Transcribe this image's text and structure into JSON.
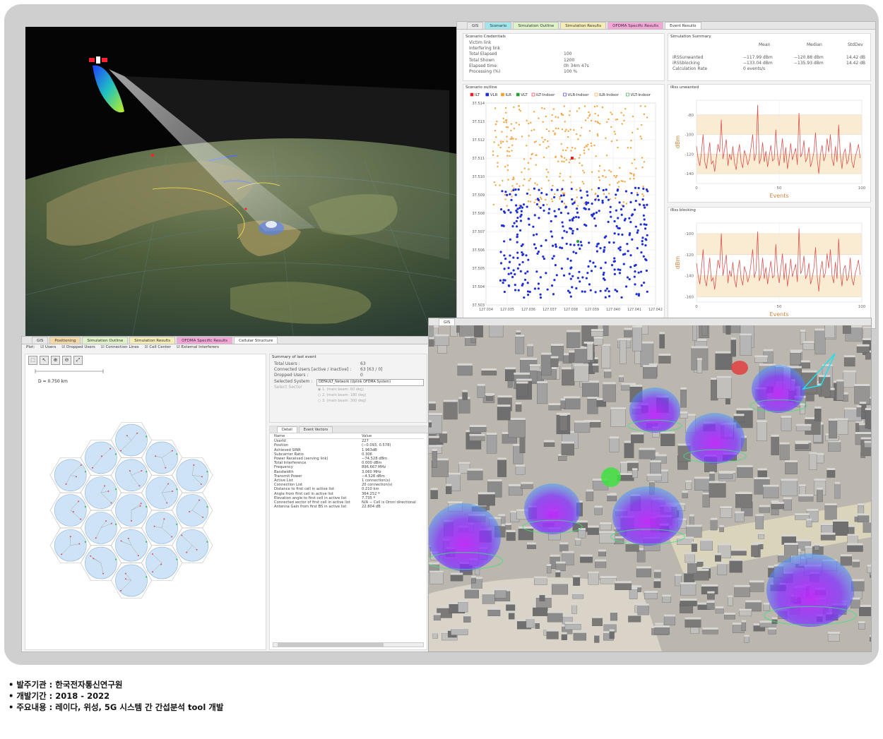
{
  "window_tabs_top": [
    {
      "label": "GIS",
      "color": "#e9e9e9"
    },
    {
      "label": "Scenario",
      "color": "#9fe6ef"
    },
    {
      "label": "Simulation Outline",
      "color": "#dff3c7"
    },
    {
      "label": "Simulation Results",
      "color": "#f6ecb6"
    },
    {
      "label": "OFDMA Specific Results",
      "color": "#f4a6d9"
    },
    {
      "label": "Event Results",
      "color": "#ffffff"
    }
  ],
  "window_tabs_bottom": [
    {
      "label": "GIS",
      "color": "#e9e9e9"
    },
    {
      "label": "Positioning",
      "color": "#f4d9a6"
    },
    {
      "label": "Simulation Outline",
      "color": "#dff3c7"
    },
    {
      "label": "Simulation Results",
      "color": "#f6ecb6"
    },
    {
      "label": "OFDMA Specific Results",
      "color": "#f4a6d9"
    },
    {
      "label": "Cellular Structure",
      "color": "#ffffff"
    }
  ],
  "city_tab": "GIS",
  "scenario_credentials": {
    "title": "Scenario Credentials",
    "labels": [
      "Victim link",
      "Interfering link",
      "Total Elapsed",
      "Total Shown",
      "Elapsed time:",
      "Processing (%)"
    ],
    "values": [
      "",
      "",
      "100",
      "1200",
      "0h 34m 47s",
      "100 %"
    ]
  },
  "simulation_summary": {
    "title": "Simulation Summary",
    "headers": [
      "Mean",
      "Median",
      "StdDev"
    ],
    "rows": [
      {
        "label": "iRSSunwanted",
        "mean": "−117.99 dBm",
        "median": "−120.88 dBm",
        "std": "14.42 dB"
      },
      {
        "label": "iRSSblocking",
        "mean": "−133.04 dBm",
        "median": "−135.93 dBm",
        "std": "14.42 dB"
      },
      {
        "label": "Calculation Rate",
        "mean": "0 events/s",
        "median": "",
        "std": ""
      }
    ]
  },
  "scenario_outline": {
    "title": "Scenario outline",
    "legend": [
      "ILT",
      "VLR",
      "ILR",
      "VLT",
      "ILT-Indoor",
      "VLR-Indoor",
      "ILR-Indoor",
      "VLT-Indoor"
    ],
    "y_ticks": [
      "37.514",
      "37.513",
      "37.512",
      "37.511",
      "37.510",
      "37.509",
      "37.508",
      "37.507",
      "37.506",
      "37.505",
      "37.504",
      "37.503"
    ],
    "x_ticks": [
      "127.034",
      "127.035",
      "127.036",
      "127.037",
      "127.038",
      "127.039",
      "127.040",
      "127.041",
      "127.042"
    ]
  },
  "chart_data": [
    {
      "type": "line",
      "title": "iRss unwanted",
      "ylabel": "dBm",
      "xlabel": "Events",
      "xlim": [
        0,
        100
      ],
      "ylim": [
        -150,
        -65
      ],
      "y_ticks": [
        "-80",
        "-100",
        "-120",
        "-140"
      ],
      "x_ticks": [
        "0",
        "50",
        "100"
      ],
      "series": [
        {
          "values": [
            -112,
            -125,
            -132,
            -118,
            -100,
            -128,
            -135,
            -122,
            -108,
            -130,
            -127,
            -138,
            -124,
            -110,
            -118,
            -85,
            -125,
            -115,
            -105,
            -132,
            -120,
            -126,
            -112,
            -129,
            -136,
            -120,
            -110,
            -128,
            -134,
            -116,
            -122,
            -131,
            -125,
            -113,
            -100,
            -127,
            -120,
            -70,
            -130,
            -124,
            -108,
            -128,
            -117,
            -133,
            -122,
            -111,
            -127,
            -125,
            -95,
            -121,
            -132,
            -118,
            -104,
            -129,
            -113,
            -135,
            -124,
            -109,
            -126,
            -120,
            -114,
            -131,
            -78,
            -123,
            -119,
            -106,
            -128,
            -124,
            -113,
            -133,
            -127,
            -118,
            -98,
            -125,
            -140,
            -120,
            -111,
            -127,
            -122,
            -104,
            -118,
            -100,
            -125,
            -132,
            -112,
            -128,
            -90,
            -121,
            -135,
            -119,
            -115,
            -130,
            -126,
            -108,
            -128,
            -134,
            -123,
            -117,
            -110,
            -124
          ]
        }
      ]
    },
    {
      "type": "line",
      "title": "iRss blocking",
      "ylabel": "dBm",
      "xlabel": "Events",
      "xlim": [
        0,
        100
      ],
      "ylim": [
        -165,
        -90
      ],
      "y_ticks": [
        "-100",
        "-120",
        "-140",
        "-160"
      ],
      "x_ticks": [
        "0",
        "50",
        "100"
      ],
      "series": [
        {
          "values": [
            -128,
            -140,
            -148,
            -133,
            -115,
            -143,
            -150,
            -137,
            -123,
            -145,
            -142,
            -153,
            -139,
            -125,
            -133,
            -100,
            -140,
            -130,
            -120,
            -147,
            -135,
            -141,
            -127,
            -144,
            -151,
            -135,
            -125,
            -143,
            -149,
            -131,
            -137,
            -146,
            -140,
            -128,
            -115,
            -142,
            -135,
            -98,
            -145,
            -139,
            -123,
            -143,
            -132,
            -148,
            -137,
            -126,
            -142,
            -140,
            -110,
            -136,
            -147,
            -133,
            -119,
            -144,
            -128,
            -150,
            -139,
            -124,
            -141,
            -135,
            -129,
            -146,
            -95,
            -138,
            -134,
            -121,
            -143,
            -139,
            -128,
            -148,
            -142,
            -133,
            -113,
            -140,
            -155,
            -135,
            -126,
            -142,
            -137,
            -119,
            -133,
            -115,
            -140,
            -147,
            -127,
            -143,
            -105,
            -136,
            -150,
            -134,
            -130,
            -145,
            -141,
            -123,
            -143,
            -149,
            -138,
            -132,
            -125,
            -139
          ]
        }
      ]
    }
  ],
  "cellular": {
    "plot_label": "Plot:",
    "checks": [
      "Users",
      "Dropped Users",
      "Connection Lines",
      "Cell Center",
      "External Interferers"
    ],
    "scale_label": "D = 0.750 km",
    "summary_title": "Summary of last event",
    "summary_labels": [
      "Total Users :",
      "Connected Users [active / inactive] :",
      "Dropped Users :",
      "Selected System :",
      "Select Sector"
    ],
    "summary_values": [
      "63",
      "63 [63 / 0]",
      "0",
      "DEFAULT_Network (Uplink OFDMA System)",
      ""
    ],
    "sectors": [
      "1. (main beam: 60 deg)",
      "2. (main beam: 180 deg)",
      "3. (main beam: 300 deg)"
    ],
    "detail_tabs": [
      "Detail",
      "Event Vectors"
    ],
    "detail_headers": [
      "Name",
      "Value"
    ],
    "detail_rows": [
      [
        "UserId",
        "227"
      ],
      [
        "Position",
        "(−0.093, 0.578)"
      ],
      [
        "Achieved SINR",
        "1.963dB"
      ],
      [
        "Subcarrier Ratio",
        "0.306"
      ],
      [
        "Power Received (serving link)",
        "−74.528 dBm"
      ],
      [
        "Total Interference",
        "0.000 dBm"
      ],
      [
        "Frequency",
        "896.667 MHz"
      ],
      [
        "Bandwidth",
        "3.060 MHz"
      ],
      [
        "Transmit Power",
        "−4.528 dBm"
      ],
      [
        "Active List",
        "1 connection(s)"
      ],
      [
        "Connection List",
        "20 connection(s)"
      ],
      [
        "Distance to first cell in active list",
        "0.210 km"
      ],
      [
        "Angle from first cell in active list",
        "364.252 º"
      ],
      [
        "Elevation angle to first cell in active list",
        "7.735 º"
      ],
      [
        "Connected sector of first cell in active list",
        "N/A − Cell is Omni directional"
      ],
      [
        "Antenna Gain from first BS in active list",
        "22.804 dB"
      ]
    ]
  },
  "footer": [
    {
      "label": "• 발주기관 : ",
      "value": "한국전자통신연구원"
    },
    {
      "label": "• 개발기간 : ",
      "value": "2018 - 2022"
    },
    {
      "label": "• 주요내용 : ",
      "value": "레이다, 위성, 5G 시스템 간 간섭분석 tool 개발"
    }
  ]
}
